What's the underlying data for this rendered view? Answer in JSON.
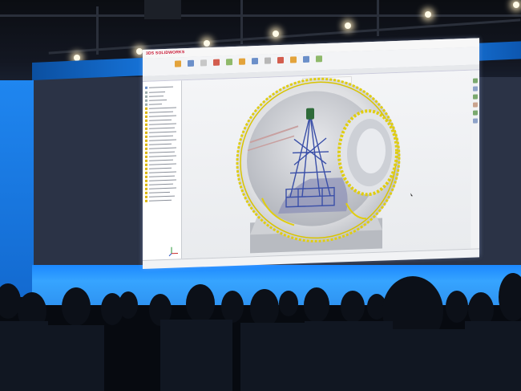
{
  "scene": {
    "description_type": "photo of a conference keynote screen showing CAD software",
    "colors": {
      "stage_blue": "#1e8cff",
      "cad_yellow": "#e6d200",
      "structure_blue": "#3a4fa8",
      "dark_venue": "#0a0d14"
    }
  },
  "cad_app": {
    "logo_text": "3DS SOLIDWORKS",
    "icons": {
      "feature_tree": "assembly-tree-icon",
      "origin_triad": "axis-triad-icon",
      "view_tools": "heads-up-view-toolbar-icon"
    }
  }
}
